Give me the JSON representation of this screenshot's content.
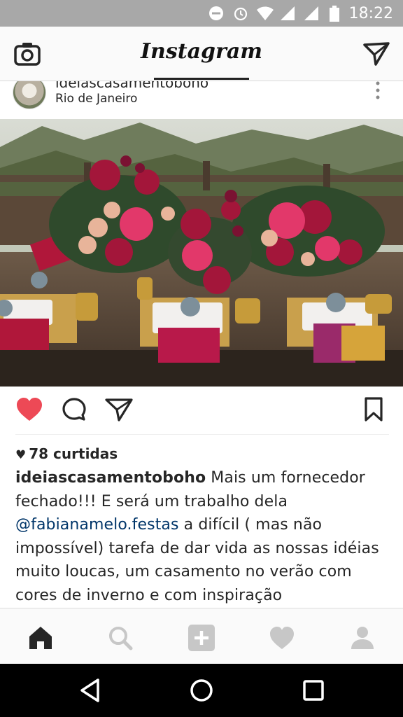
{
  "status_bar": {
    "time": "18:22"
  },
  "app": {
    "title": "Instagram"
  },
  "post": {
    "username": "ideiascasamentoboho",
    "location": "Rio de Janeiro",
    "likes": "78 curtidas",
    "caption_user": "ideiascasamentoboho",
    "caption_part1": " Mais um fornecedor fechado!!! E será um trabalho dela ",
    "mention": "@fabianamelo.festas",
    "caption_part2": " a difícil ( mas não impossível) tarefa de dar vida as nossas idéias muito loucas, um casamento no verão com cores de inverno e com inspiração"
  },
  "colors": {
    "like_red": "#ed4956",
    "status_gray": "#a8a8a8",
    "mention_blue": "#003569"
  },
  "icons": [
    "camera-icon",
    "direct-message-icon",
    "more-options-icon",
    "heart-icon",
    "comment-icon",
    "share-icon",
    "bookmark-icon",
    "home-icon",
    "search-icon",
    "add-icon",
    "activity-icon",
    "profile-icon",
    "back-icon",
    "home-circle-icon",
    "recents-icon"
  ]
}
